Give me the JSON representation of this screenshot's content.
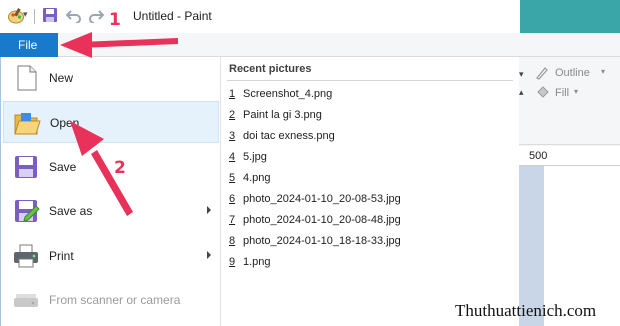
{
  "window": {
    "title": "Untitled - Paint"
  },
  "file_tab": {
    "label": "File"
  },
  "menu": {
    "items": [
      {
        "label": "New",
        "icon": "new-document-icon",
        "has_submenu": false,
        "disabled": false
      },
      {
        "label": "Open",
        "icon": "open-folder-icon",
        "has_submenu": false,
        "disabled": false
      },
      {
        "label": "Save",
        "icon": "save-disk-icon",
        "has_submenu": false,
        "disabled": false
      },
      {
        "label": "Save as",
        "icon": "save-as-icon",
        "has_submenu": true,
        "disabled": false
      },
      {
        "label": "Print",
        "icon": "printer-icon",
        "has_submenu": true,
        "disabled": false
      },
      {
        "label": "From scanner or camera",
        "icon": "scanner-icon",
        "has_submenu": false,
        "disabled": true
      }
    ]
  },
  "recent": {
    "heading": "Recent pictures",
    "items": [
      {
        "num": "1",
        "name": "Screenshot_4.png"
      },
      {
        "num": "2",
        "name": "Paint la gi 3.png"
      },
      {
        "num": "3",
        "name": "doi tac exness.png"
      },
      {
        "num": "4",
        "name": "5.jpg"
      },
      {
        "num": "5",
        "name": "4.png"
      },
      {
        "num": "6",
        "name": "photo_2024-01-10_20-08-53.jpg"
      },
      {
        "num": "7",
        "name": "photo_2024-01-10_20-08-48.jpg"
      },
      {
        "num": "8",
        "name": "photo_2024-01-10_18-18-33.jpg"
      },
      {
        "num": "9",
        "name": "1.png"
      }
    ]
  },
  "ribbon": {
    "outline_label": "Outline",
    "fill_label": "Fill",
    "ruler_value": "500"
  },
  "annotations": {
    "step1": "1",
    "step2": "2",
    "watermark": "Thuthuattienich.com"
  },
  "colors": {
    "file_tab": "#1979ca",
    "hover": "#e5f1fb",
    "annotation": "#e8325a"
  }
}
